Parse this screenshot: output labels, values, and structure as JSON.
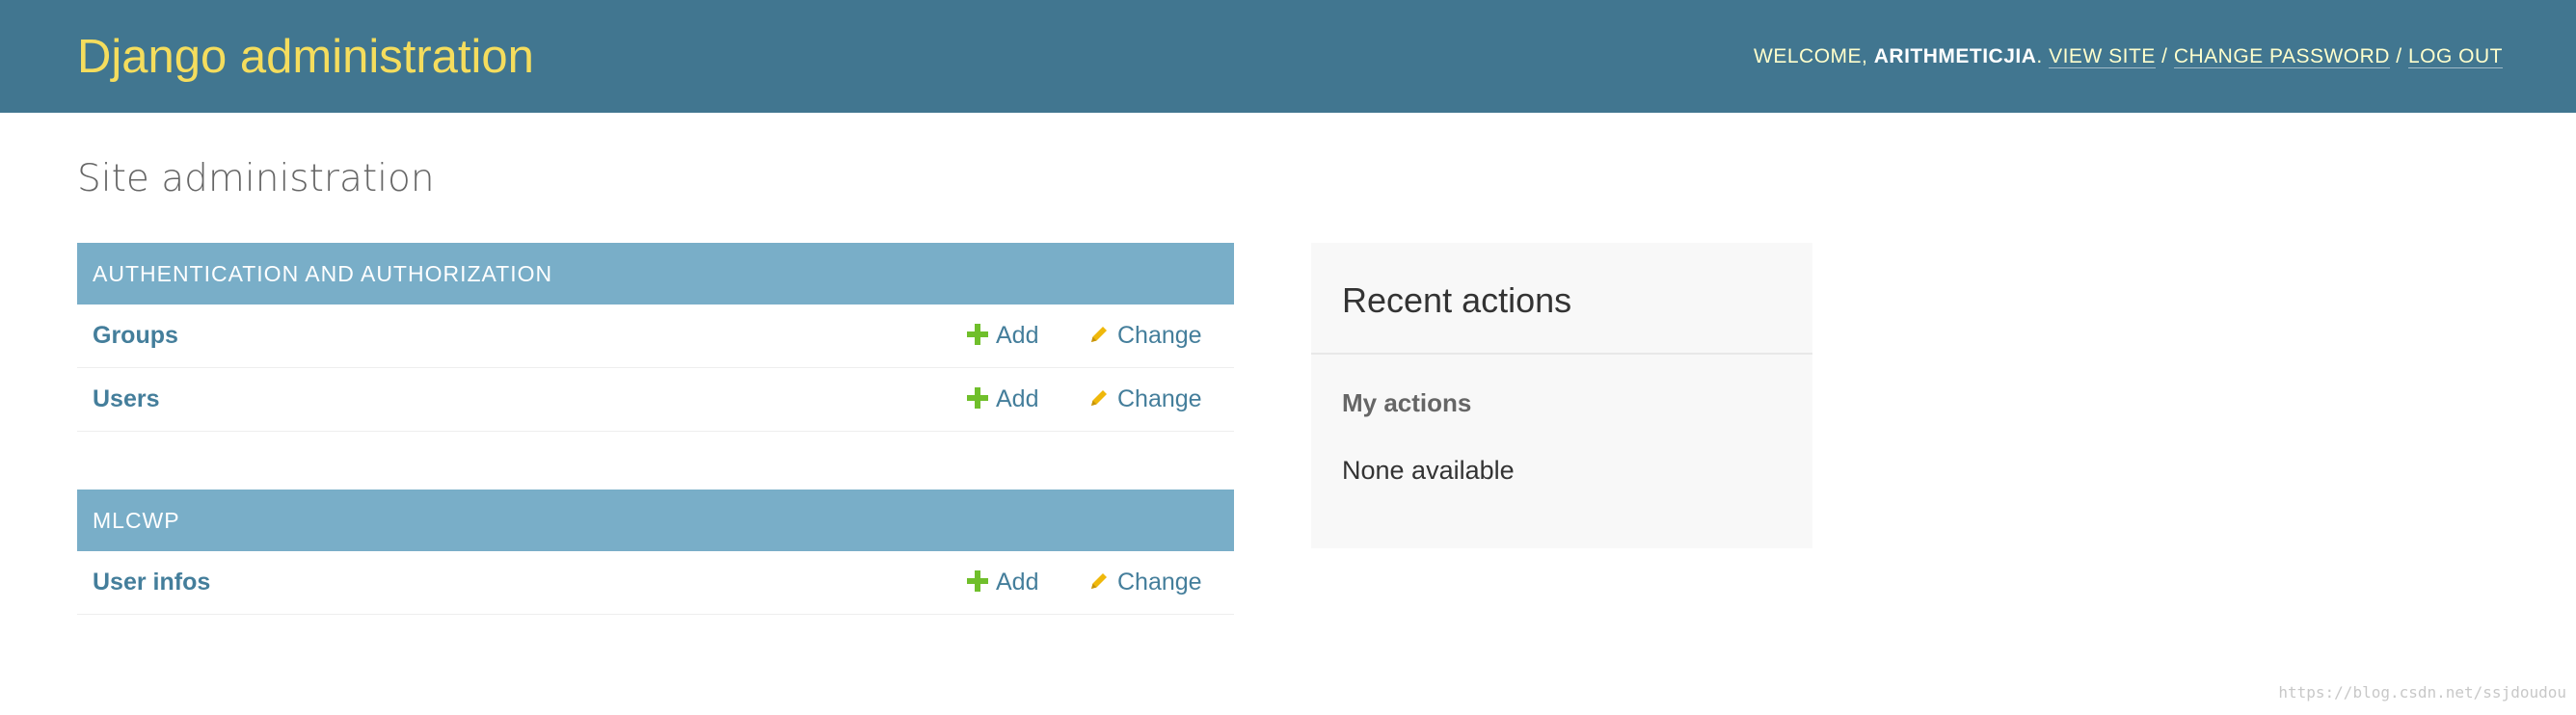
{
  "header": {
    "brand": "Django administration",
    "welcome_label": "WELCOME, ",
    "username": "ARITHMETICJIA",
    "period": ".",
    "links": {
      "view_site": "VIEW SITE",
      "change_password": "CHANGE PASSWORD",
      "log_out": "LOG OUT"
    },
    "separator": "/"
  },
  "page": {
    "title": "Site administration"
  },
  "modules": [
    {
      "caption": "AUTHENTICATION AND AUTHORIZATION",
      "rows": [
        {
          "label": "Groups",
          "add": "Add",
          "change": "Change"
        },
        {
          "label": "Users",
          "add": "Add",
          "change": "Change"
        }
      ]
    },
    {
      "caption": "MLCWP",
      "rows": [
        {
          "label": "User infos",
          "add": "Add",
          "change": "Change"
        }
      ]
    }
  ],
  "recent_actions": {
    "title": "Recent actions",
    "subtitle": "My actions",
    "empty_text": "None available"
  },
  "watermark": "https://blog.csdn.net/ssjdoudou",
  "colors": {
    "header_bg": "#417690",
    "brand": "#f5dd5d",
    "module_caption_bg": "#79aec8",
    "link": "#447e9b",
    "add_icon": "#70bf2b",
    "change_icon": "#efb80b"
  },
  "icons": {
    "add": "plus-icon",
    "change": "pencil-icon"
  }
}
